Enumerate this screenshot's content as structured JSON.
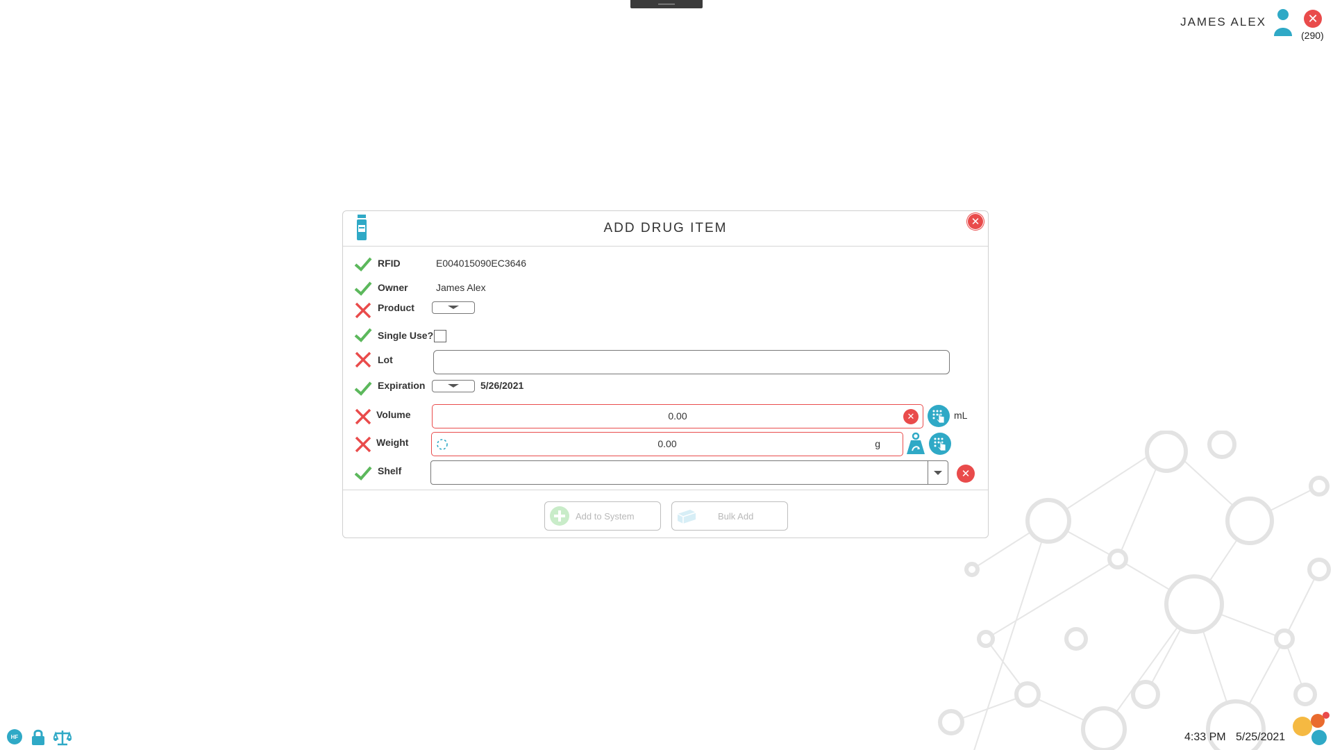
{
  "header": {
    "user_name": "JAMES ALEX",
    "notification_count": "(290)",
    "notification_glyph": "✕"
  },
  "dialog": {
    "title": "ADD DRUG ITEM",
    "close_glyph": "✕",
    "fields": {
      "rfid": {
        "label": "RFID",
        "value": "E004015090EC3646",
        "status": "valid"
      },
      "owner": {
        "label": "Owner",
        "value": "James Alex",
        "status": "valid"
      },
      "product": {
        "label": "Product",
        "status": "invalid"
      },
      "single_use": {
        "label": "Single Use?",
        "checked": false,
        "status": "valid"
      },
      "lot": {
        "label": "Lot",
        "value": "",
        "status": "invalid"
      },
      "expiration": {
        "label": "Expiration",
        "value": "5/26/2021",
        "status": "valid"
      },
      "volume": {
        "label": "Volume",
        "value": "0.00",
        "unit": "mL",
        "status": "invalid"
      },
      "weight": {
        "label": "Weight",
        "value": "0.00",
        "unit": "g",
        "status": "invalid"
      },
      "shelf": {
        "label": "Shelf",
        "value": "",
        "status": "valid"
      }
    },
    "buttons": {
      "add_to_system": "Add to System",
      "bulk_add": "Bulk Add"
    }
  },
  "status_bar": {
    "time": "4:33 PM",
    "date": "5/25/2021",
    "badge": "HF"
  },
  "colors": {
    "accent": "#2fa9c6",
    "error": "#e94b4b",
    "ok": "#5cb85c"
  }
}
